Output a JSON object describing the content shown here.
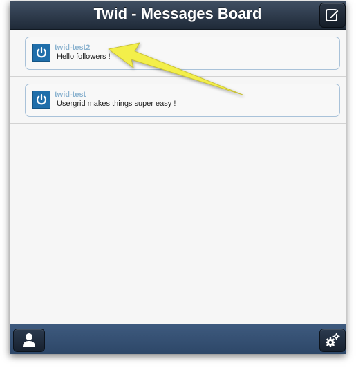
{
  "header": {
    "title": "Twid - Messages Board",
    "compose_icon": "compose-icon"
  },
  "messages": [
    {
      "user": "twid-test2",
      "text": "Hello followers !"
    },
    {
      "user": "twid-test",
      "text": "Usergrid makes things super easy !"
    }
  ],
  "footer": {
    "profile_icon": "user-icon",
    "settings_icon": "gears-icon"
  },
  "colors": {
    "header": "#2a3647",
    "footer": "#35506f",
    "username": "#8ab2cf",
    "card_border": "#a9c2d9",
    "avatar": "#1f6eaa",
    "annotation_arrow": "#f3ef4a"
  }
}
